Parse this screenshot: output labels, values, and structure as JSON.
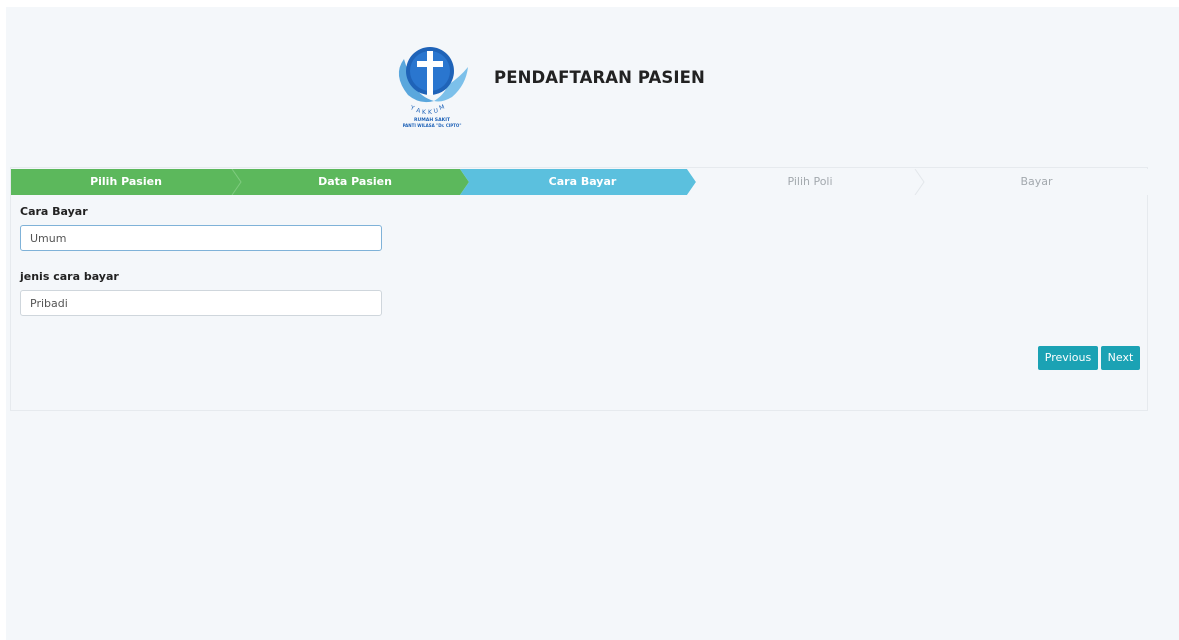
{
  "header": {
    "title": "PENDAFTARAN PASIEN",
    "logo": {
      "arc_text": "YAKKUM",
      "line1": "RUMAH SAKIT",
      "line2": "PANTI WILASA \"Dr. CIPTO\"",
      "icon": "cross-dove-logo"
    }
  },
  "wizard": {
    "steps": [
      {
        "label": "Pilih Pasien",
        "state": "done"
      },
      {
        "label": "Data Pasien",
        "state": "done"
      },
      {
        "label": "Cara Bayar",
        "state": "current"
      },
      {
        "label": "Pilih Poli",
        "state": "todo"
      },
      {
        "label": "Bayar",
        "state": "todo"
      }
    ],
    "colors": {
      "done": "#5cb85c",
      "current": "#5bc0de",
      "todo": "#f4f7fa"
    }
  },
  "form": {
    "cara_bayar": {
      "label": "Cara Bayar",
      "value": "Umum"
    },
    "jenis_cara_bayar": {
      "label": "jenis cara bayar",
      "value": "Pribadi"
    }
  },
  "actions": {
    "previous_label": "Previous",
    "next_label": "Next",
    "button_color": "#1ba2b4"
  }
}
